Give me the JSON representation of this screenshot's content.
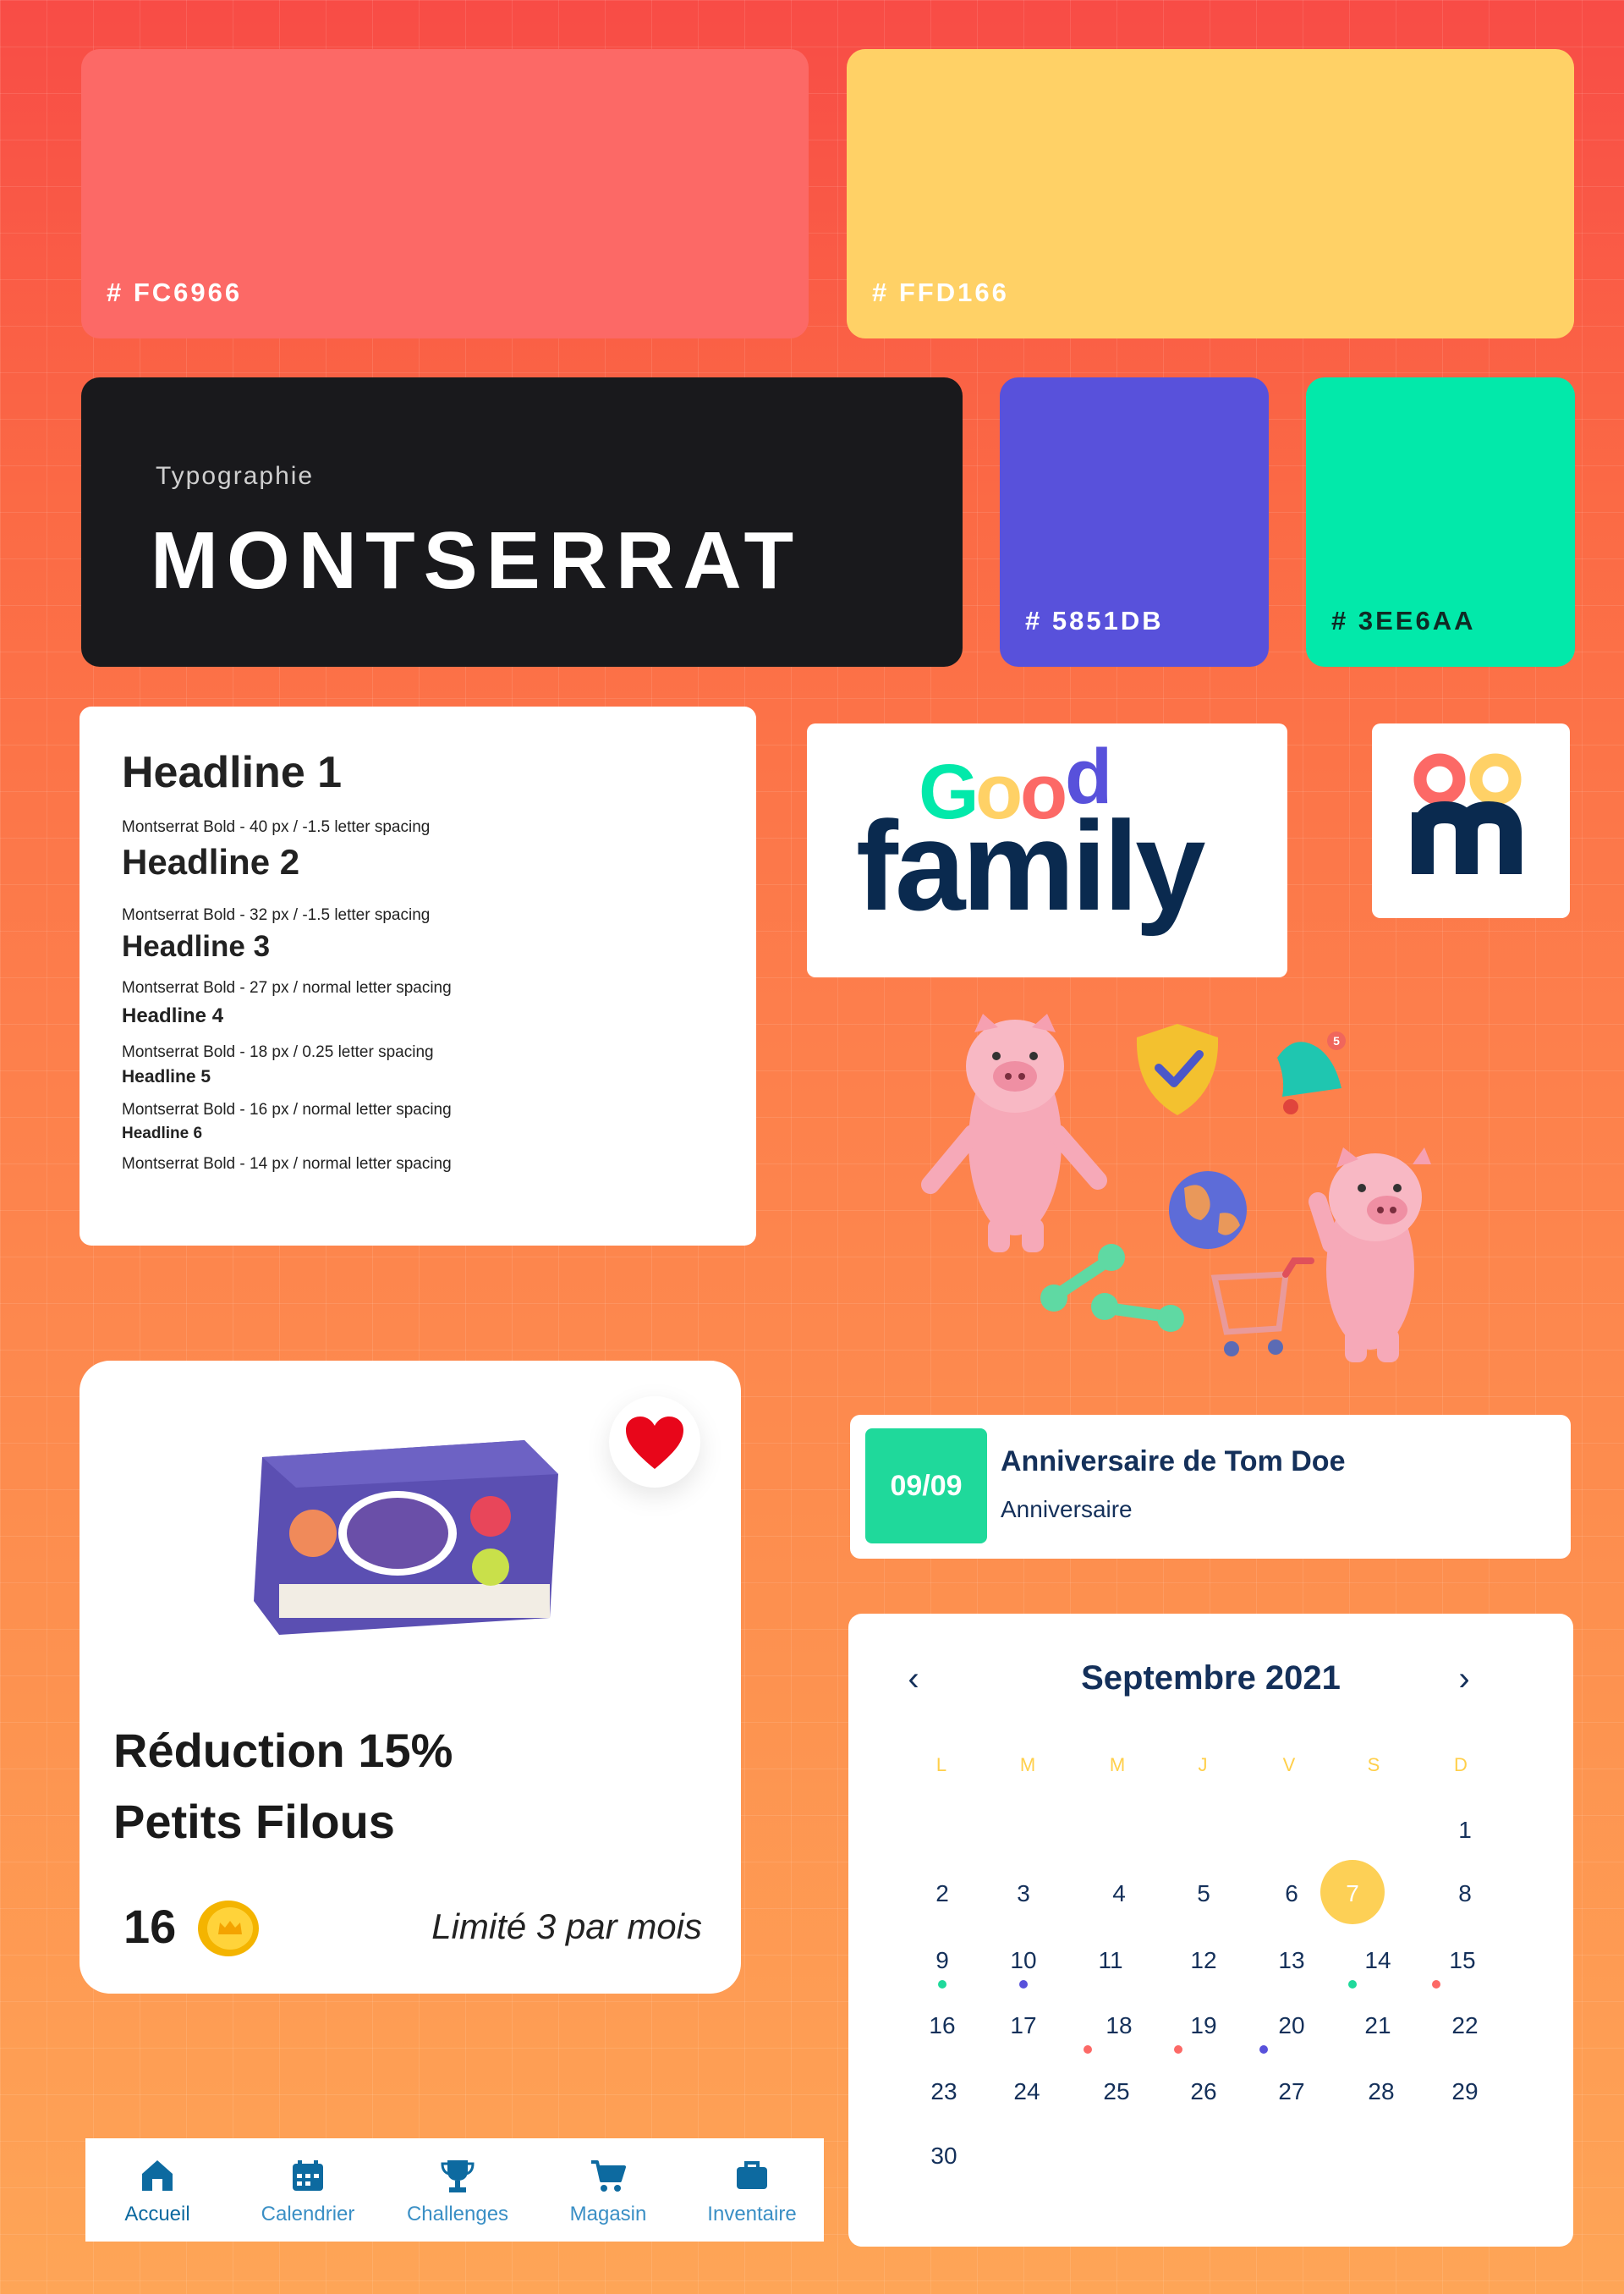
{
  "palette": {
    "red": {
      "label": "# FC6966",
      "color": "#FC6966"
    },
    "yellow": {
      "label": "# FFD166",
      "color": "#FFD166"
    },
    "blue": {
      "label": "# 5851DB",
      "color": "#5851DB"
    },
    "green": {
      "label": "# 3EE6AA",
      "color": "#3EE6AA"
    }
  },
  "typography": {
    "label": "Typographie",
    "font_name": "MONTSERRAT"
  },
  "headlines": [
    {
      "title": "Headline 1",
      "spec": "Montserrat Bold - 40 px / -1.5 letter spacing"
    },
    {
      "title": "Headline 2",
      "spec": "Montserrat Bold - 32 px / -1.5 letter spacing"
    },
    {
      "title": "Headline 3",
      "spec": "Montserrat Bold - 27 px / normal letter spacing"
    },
    {
      "title": "Headline 4",
      "spec": "Montserrat Bold - 18 px / 0.25  letter spacing"
    },
    {
      "title": "Headline 5",
      "spec": "Montserrat Bold - 16 px / normal letter spacing"
    },
    {
      "title": "Headline 6",
      "spec": "Montserrat Bold - 14 px / normal letter spacing"
    }
  ],
  "logo": {
    "line1": "Good",
    "line2": "family"
  },
  "product": {
    "title_line1": "Réduction 15%",
    "title_line2": "Petits Filous",
    "price": "16",
    "limit": "Limité 3 par mois"
  },
  "event": {
    "date": "09/09",
    "title": "Anniversaire de Tom Doe",
    "type": "Anniversaire"
  },
  "calendar": {
    "title": "Septembre 2021",
    "weekdays": [
      "L",
      "M",
      "M",
      "J",
      "V",
      "S",
      "D"
    ],
    "days": [
      "1",
      "2",
      "3",
      "4",
      "5",
      "6",
      "7",
      "8",
      "9",
      "10",
      "11",
      "12",
      "13",
      "14",
      "15",
      "16",
      "17",
      "18",
      "19",
      "20",
      "21",
      "22",
      "23",
      "24",
      "25",
      "26",
      "27",
      "28",
      "29",
      "30"
    ],
    "today": "7"
  },
  "nav": [
    {
      "label": "Accueil",
      "icon": "home-icon"
    },
    {
      "label": "Calendrier",
      "icon": "calendar-icon"
    },
    {
      "label": "Challenges",
      "icon": "trophy-icon"
    },
    {
      "label": "Magasin",
      "icon": "cart-icon"
    },
    {
      "label": "Inventaire",
      "icon": "briefcase-icon"
    }
  ]
}
